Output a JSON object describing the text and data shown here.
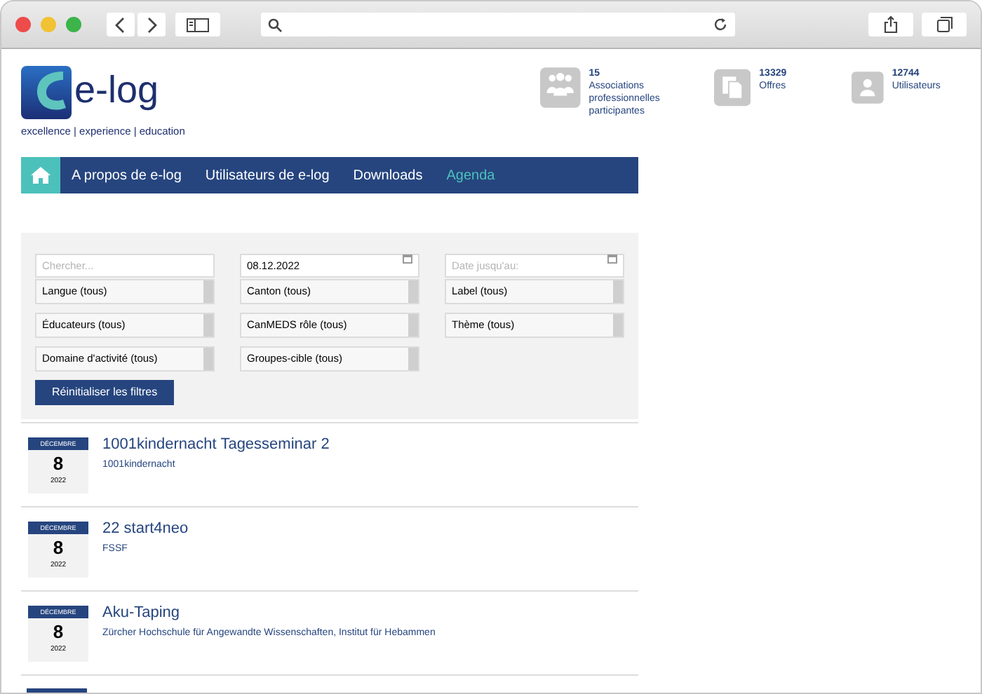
{
  "logo": {
    "name": "e-log",
    "tagline": "excellence | experience | education"
  },
  "stats": [
    {
      "kind": "associations",
      "count": "15",
      "label": "Associations professionnelles participantes"
    },
    {
      "kind": "offers",
      "count": "13329",
      "label": "Offres"
    },
    {
      "kind": "users",
      "count": "12744",
      "label": "Utilisateurs"
    }
  ],
  "nav": [
    {
      "label": "A propos de e-log",
      "selected": false
    },
    {
      "label": "Utilisateurs de e-log",
      "selected": false
    },
    {
      "label": "Downloads",
      "selected": false
    },
    {
      "label": "Agenda",
      "selected": true
    }
  ],
  "filters": {
    "search": {
      "placeholder": "Chercher..."
    },
    "date_from": {
      "value": "08.12.2022"
    },
    "date_to": {
      "placeholder": "Date jusqu'au:"
    },
    "selects": [
      [
        "Langue (tous)",
        "Éducateurs (tous)",
        "Domaine d'activité (tous)"
      ],
      [
        "Canton (tous)",
        "CanMEDS rôle (tous)",
        "Groupes-cible (tous)"
      ],
      [
        "Label (tous)",
        "Thème (tous)"
      ]
    ],
    "reset_button": "Réinitialiser les filtres"
  },
  "events": [
    {
      "month": "DÉCEMBRE",
      "day": "8",
      "year": "2022",
      "title": "1001kindernacht Tagesseminar 2",
      "organizer": "1001kindernacht"
    },
    {
      "month": "DÉCEMBRE",
      "day": "8",
      "year": "2022",
      "title": "22 start4neo",
      "organizer": "FSSF"
    },
    {
      "month": "DÉCEMBRE",
      "day": "8",
      "year": "2022",
      "title": "Aku-Taping",
      "organizer": "Zürcher Hochschule für Angewandte Wissenschaften, Institut für Hebammen"
    }
  ]
}
